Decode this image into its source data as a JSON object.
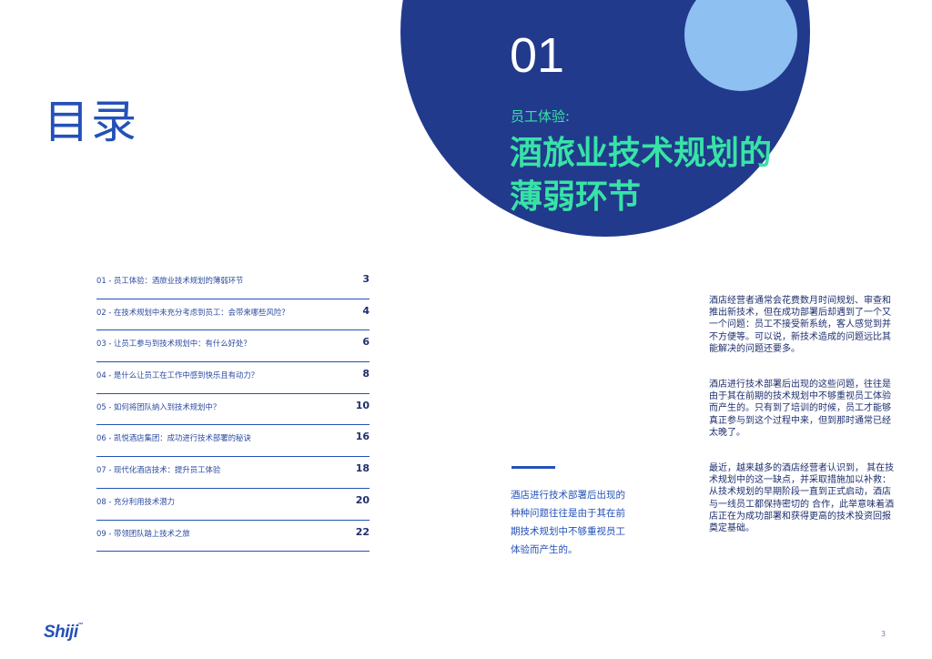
{
  "toc": {
    "heading": "目录",
    "items": [
      {
        "label": "01 - 员工体验：酒旅业技术规划的薄弱环节",
        "page": "3"
      },
      {
        "label": "02 - 在技术规划中未充分考虑到员工：会带来哪些风险？",
        "page": "4"
      },
      {
        "label": "03 - 让员工参与到技术规划中：有什么好处？",
        "page": "6"
      },
      {
        "label": "04 - 是什么让员工在工作中感到快乐且有动力？",
        "page": "8"
      },
      {
        "label": "05 - 如何将团队纳入到技术规划中？",
        "page": "10"
      },
      {
        "label": "06 - 凯悦酒店集团：成功进行技术部署的秘诀",
        "page": "16"
      },
      {
        "label": "07 - 现代化酒店技术：提升员工体验",
        "page": "18"
      },
      {
        "label": "08 - 充分利用技术潜力",
        "page": "20"
      },
      {
        "label": "09 - 带领团队踏上技术之旅",
        "page": "22"
      }
    ]
  },
  "chapter": {
    "number": "01",
    "subtitle": "员工体验:",
    "title": "酒旅业技术规划的薄弱环节"
  },
  "pull_quote": "酒店进行技术部署后出现的种种问题往往是由于其在前期技术规划中不够重视员工体验而产生的。",
  "body": {
    "paragraphs": [
      "酒店经营者通常会花费数月时间规划、审查和推出新技术，但在成功部署后却遇到了一个又一个问题：员工不接受新系统，客人感觉到并不方便等。可以说，新技术造成的问题远比其能解决的问题还要多。",
      "酒店进行技术部署后出现的这些问题，往往是由于其在前期的技术规划中不够重视员工体验而产生的。只有到了培训的时候，员工才能够真正参与到这个过程中来，但到那时通常已经太晚了。",
      "最近，越来越多的酒店经营者认识到， 其在技术规划中的这一缺点，并采取措施加以补救：从技术规划的早期阶段一直到正式启动，酒店与一线员工都保持密切的 合作，此举意味着酒店正在为成功部署和获得更高的技术投资回报奠定基础。"
    ]
  },
  "footer": {
    "logo": "Shiji",
    "page_number": "3"
  },
  "colors": {
    "navy_circle": "#223a8c",
    "light_circle": "#8ec0f2",
    "accent_green": "#37e3a6",
    "brand_blue": "#2451b8"
  }
}
